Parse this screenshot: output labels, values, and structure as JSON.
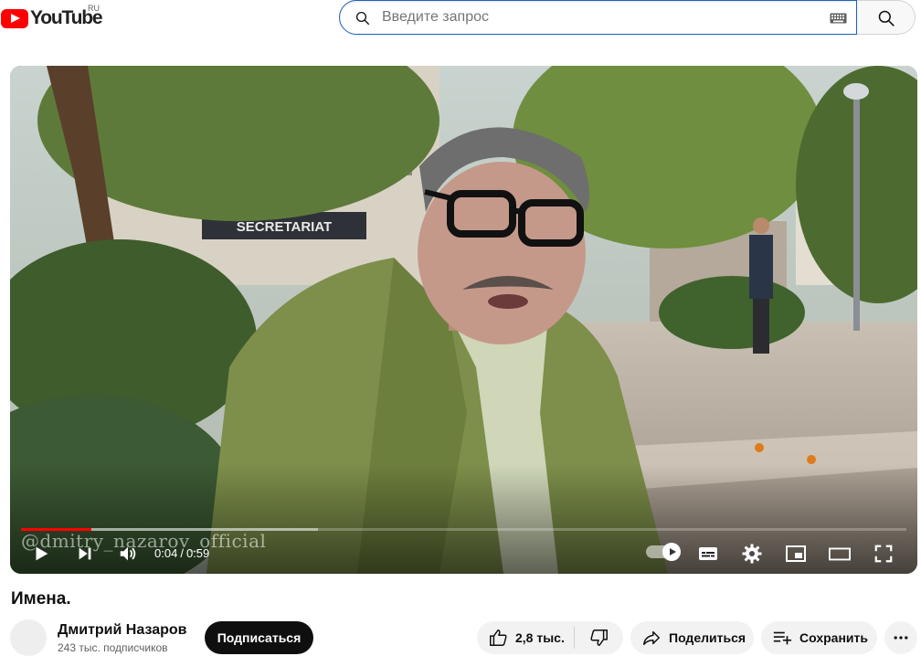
{
  "header": {
    "logo_text": "YouTube",
    "region": "RU",
    "search_placeholder": "Введите запрос",
    "icons": [
      "search-icon",
      "keyboard-icon"
    ]
  },
  "player": {
    "current_time": "0:04",
    "separator": "/",
    "duration": "0:59",
    "watermark": "@dmitry_nazarov_official",
    "played_fraction": 0.079,
    "loaded_fraction": 0.335,
    "sign_text": "SECRETARIAT",
    "icons": [
      "play-icon",
      "next-icon",
      "volume-icon",
      "autoplay-toggle",
      "subtitles-icon",
      "settings-icon",
      "miniplayer-icon",
      "theater-icon",
      "fullscreen-icon"
    ]
  },
  "video": {
    "title": "Имена."
  },
  "channel": {
    "name": "Дмитрий Назаров",
    "subscribers": "243 тыс. подписчиков",
    "subscribe_label": "Подписаться"
  },
  "actions": {
    "like_count": "2,8 тыс.",
    "share_label": "Поделиться",
    "save_label": "Сохранить",
    "icons": [
      "thumbs-up-icon",
      "thumbs-down-icon",
      "share-icon",
      "save-playlist-icon",
      "more-icon"
    ]
  },
  "colors": {
    "brand_red": "#ff0000",
    "search_focus": "#1c62b9",
    "subscribe_bg": "#0f0f0f"
  }
}
